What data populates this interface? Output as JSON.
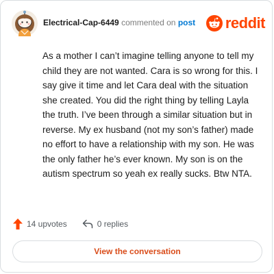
{
  "comment": {
    "author": "Electrical-Cap-6449",
    "action_text": "commented on",
    "target_link": "post",
    "body": "As a mother I can’t imagine telling anyone to tell my child they are not wanted. Cara is so wrong for this. I say give it time and let Cara deal with the situation she created. You did the right thing by telling Layla the truth. I’ve been through a similar situation but in reverse. My ex husband (not my son’s father) made no effort to have a relationship with my son. He was the only father he’s ever known. My son is on the autism spectrum so yeah ex really sucks. Btw NTA."
  },
  "brand": {
    "name": "reddit",
    "icon": "reddit-snoo-icon",
    "color": "#ff4500"
  },
  "stats": {
    "upvotes_label": "14 upvotes",
    "replies_label": "0 replies",
    "upvote_icon": "upvote-arrow-icon",
    "reply_icon": "reply-arrow-icon"
  },
  "cta": {
    "label": "View the conversation",
    "color": "#d94c1a"
  }
}
